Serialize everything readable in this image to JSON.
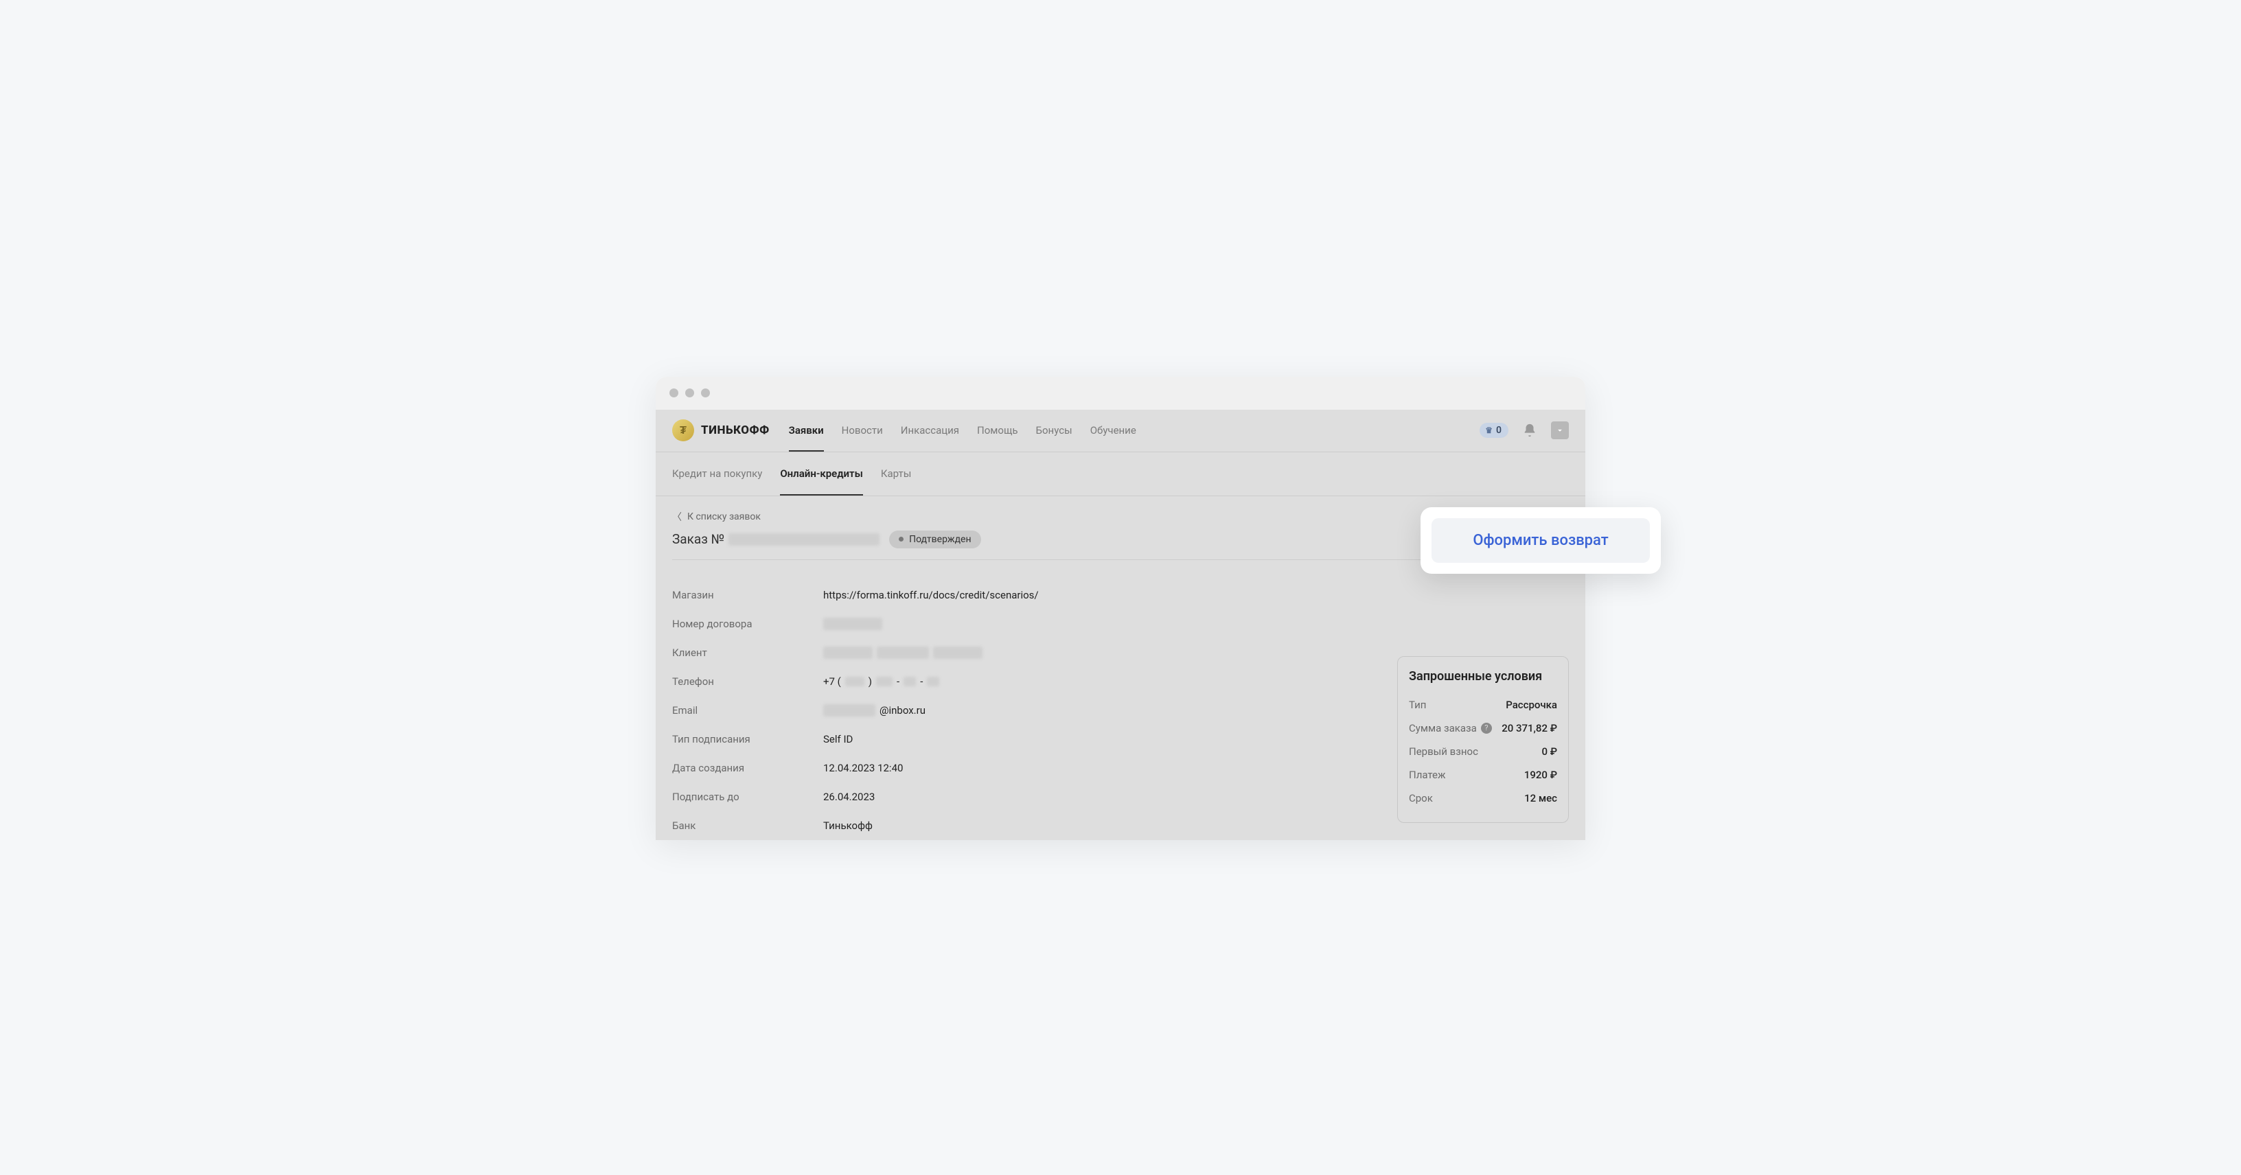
{
  "logo_text": "ТИНЬКОФФ",
  "nav": [
    "Заявки",
    "Новости",
    "Инкассация",
    "Помощь",
    "Бонусы",
    "Обучение"
  ],
  "nav_active": 0,
  "crown_count": "0",
  "sub_nav": [
    "Кредит на покупку",
    "Онлайн-кредиты",
    "Карты"
  ],
  "sub_active": 1,
  "back_link": "К списку заявок",
  "order_prefix": "Заказ №",
  "status": "Подтвержден",
  "details": {
    "store_label": "Магазин",
    "store_value": "https://forma.tinkoff.ru/docs/credit/scenarios/",
    "contract_label": "Номер договора",
    "client_label": "Клиент",
    "phone_label": "Телефон",
    "phone_prefix": "+7 (",
    "phone_mid": ") ",
    "phone_dash": "-",
    "email_label": "Email",
    "email_suffix": "@inbox.ru",
    "sign_type_label": "Тип подписания",
    "sign_type_value": "Self ID",
    "created_label": "Дата создания",
    "created_value": "12.04.2023 12:40",
    "sign_until_label": "Подписать до",
    "sign_until_value": "26.04.2023",
    "bank_label": "Банк",
    "bank_value": "Тинькофф"
  },
  "action_button": "Оформить возврат",
  "conditions": {
    "title": "Запрошенные условия",
    "type_label": "Тип",
    "type_value": "Рассрочка",
    "sum_label": "Сумма заказа",
    "sum_value": "20 371,82 ₽",
    "first_label": "Первый взнос",
    "first_value": "0 ₽",
    "payment_label": "Платеж",
    "payment_value": "1920 ₽",
    "term_label": "Срок",
    "term_value": "12 мес"
  }
}
